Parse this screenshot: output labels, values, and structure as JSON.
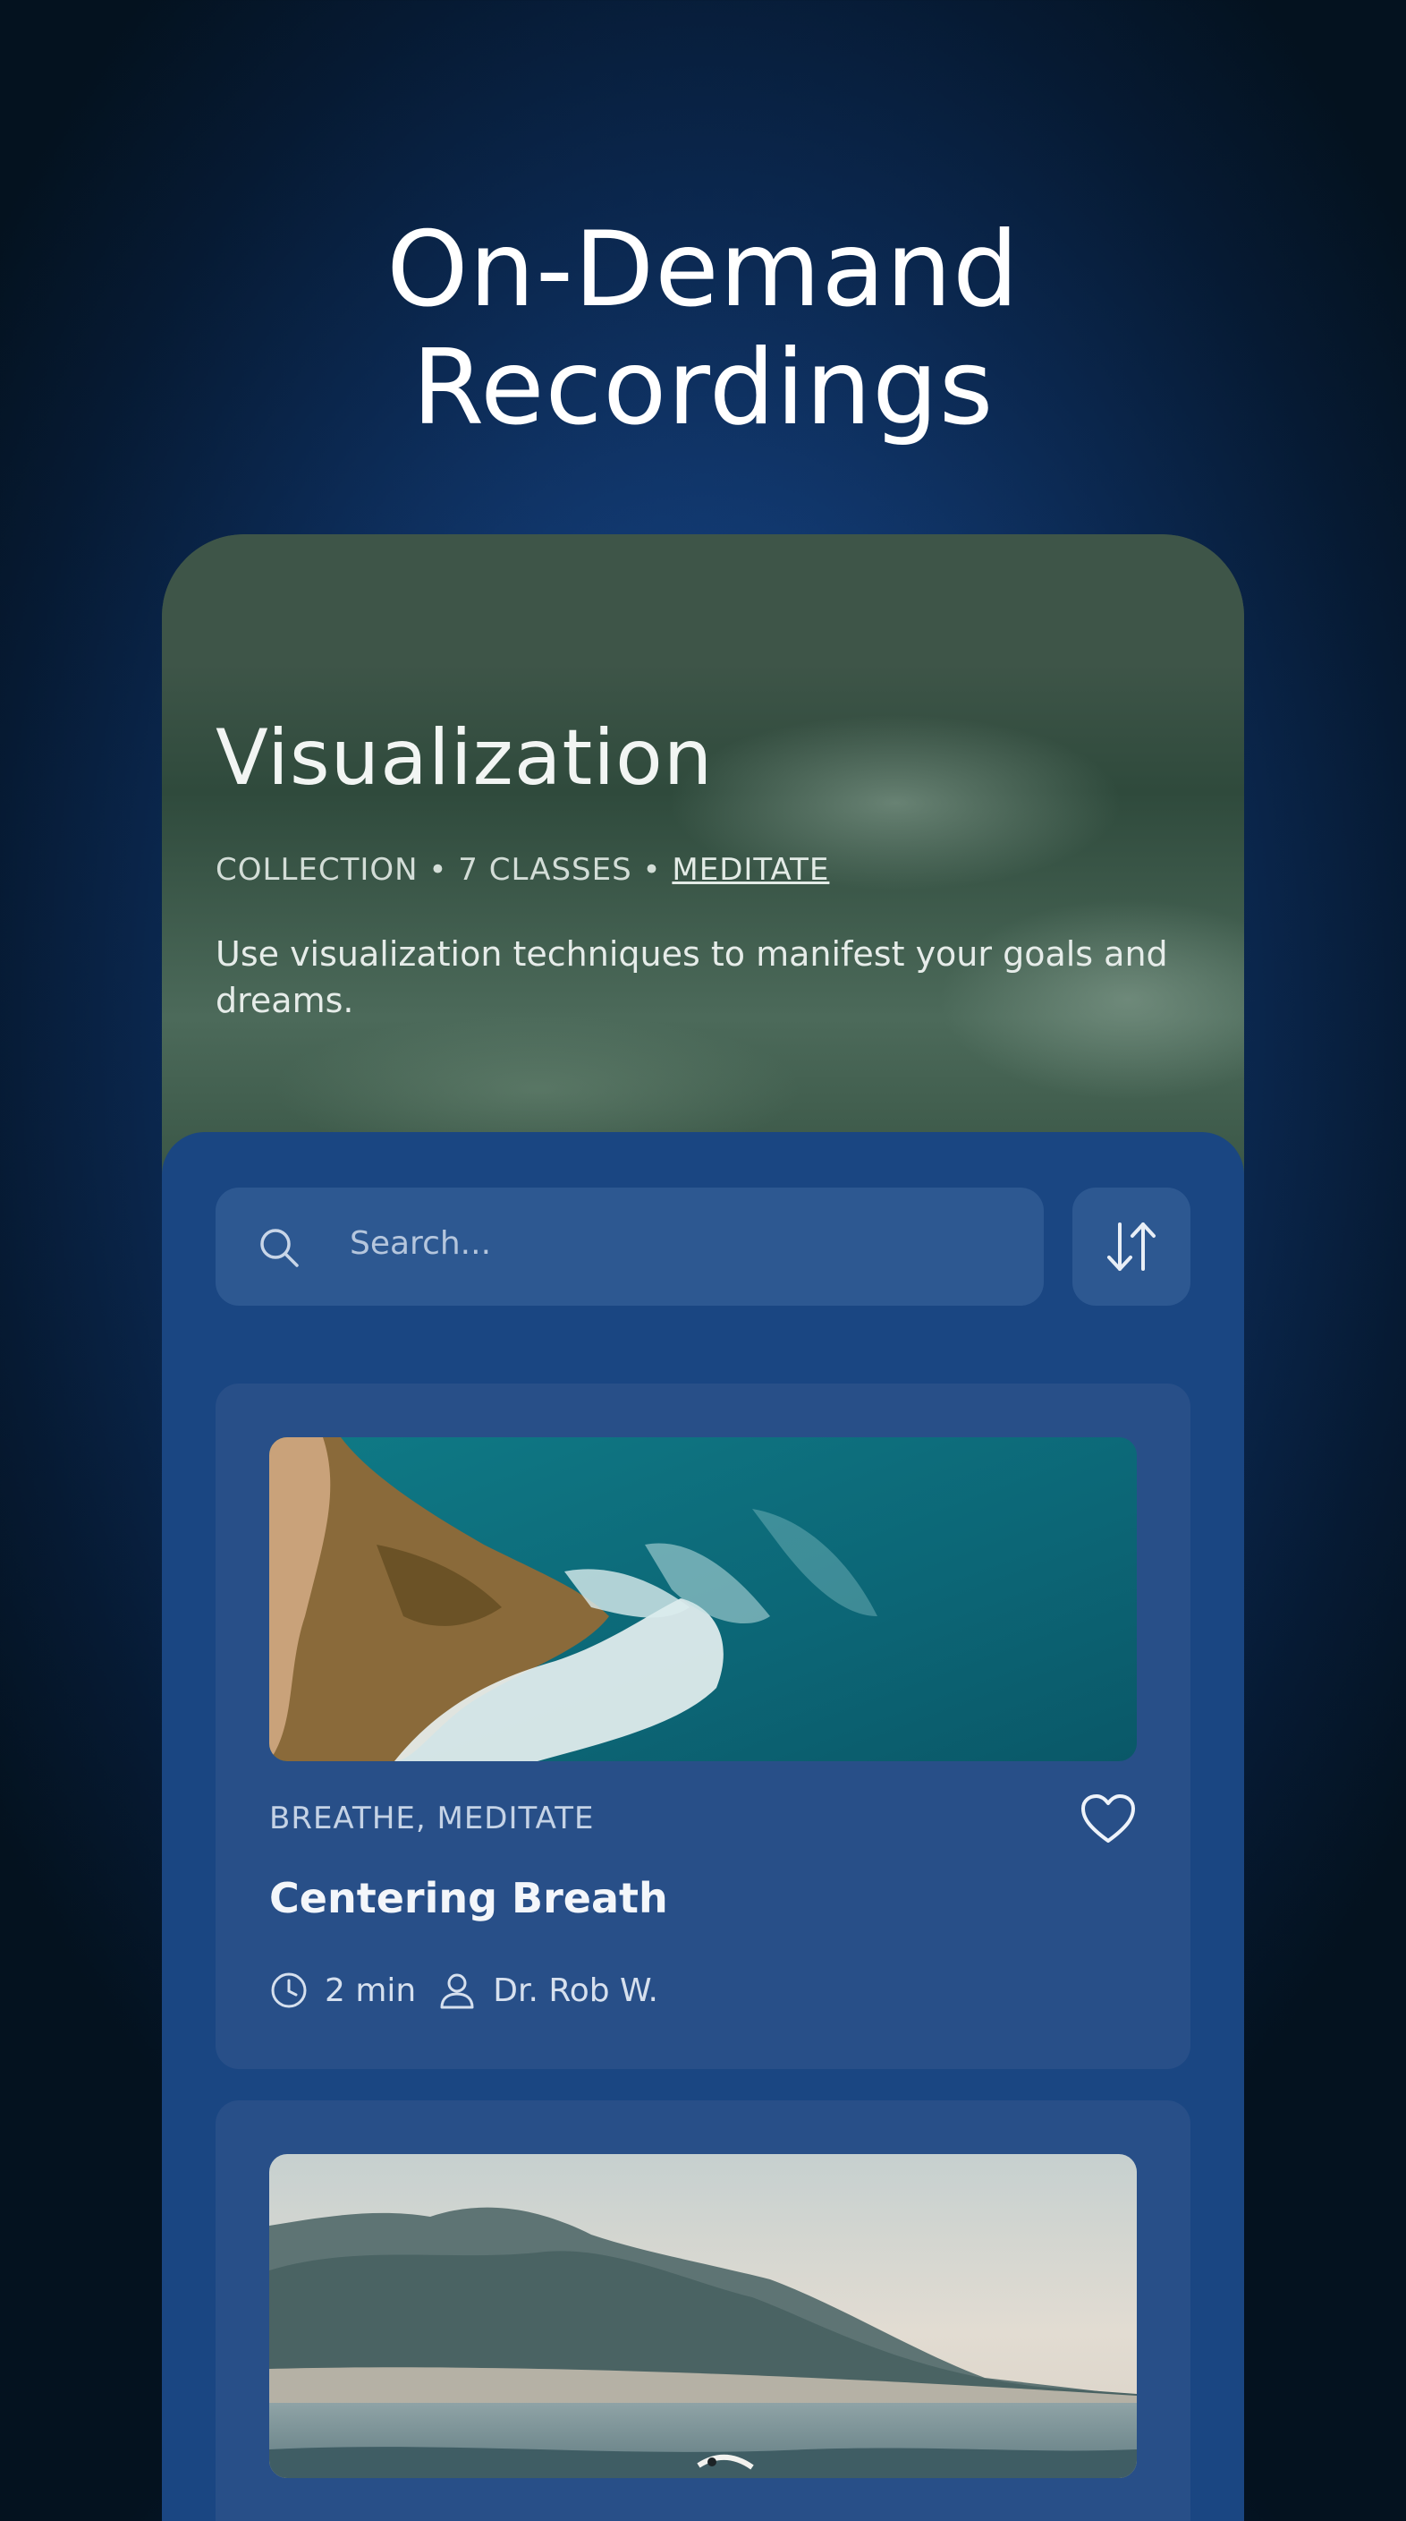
{
  "hero": {
    "title_line1": "On-Demand",
    "title_line2": "Recordings"
  },
  "collection": {
    "title": "Visualization",
    "type": "COLLECTION",
    "classes": "7 CLASSES",
    "category_link": "MEDITATE",
    "separator": "•",
    "description": "Use visualization techniques to manifest your goals and dreams."
  },
  "search": {
    "placeholder": "Search...",
    "icon": "search-icon"
  },
  "sort": {
    "icon": "sort-arrows-icon"
  },
  "cards": [
    {
      "image": "aerial rocky coastline with turquoise waves",
      "tags": "BREATHE, MEDITATE",
      "title": "Centering Breath",
      "duration": "2 min",
      "instructor": "Dr. Rob W.",
      "favorite_icon": "heart-icon"
    },
    {
      "image": "misty mountains over the sea with a surfer"
    }
  ],
  "colors": {
    "background": "#0b2850",
    "panel": "#1a4682",
    "card": "#284f88",
    "header_green": "#3e5548",
    "text_primary": "#ffffff"
  }
}
